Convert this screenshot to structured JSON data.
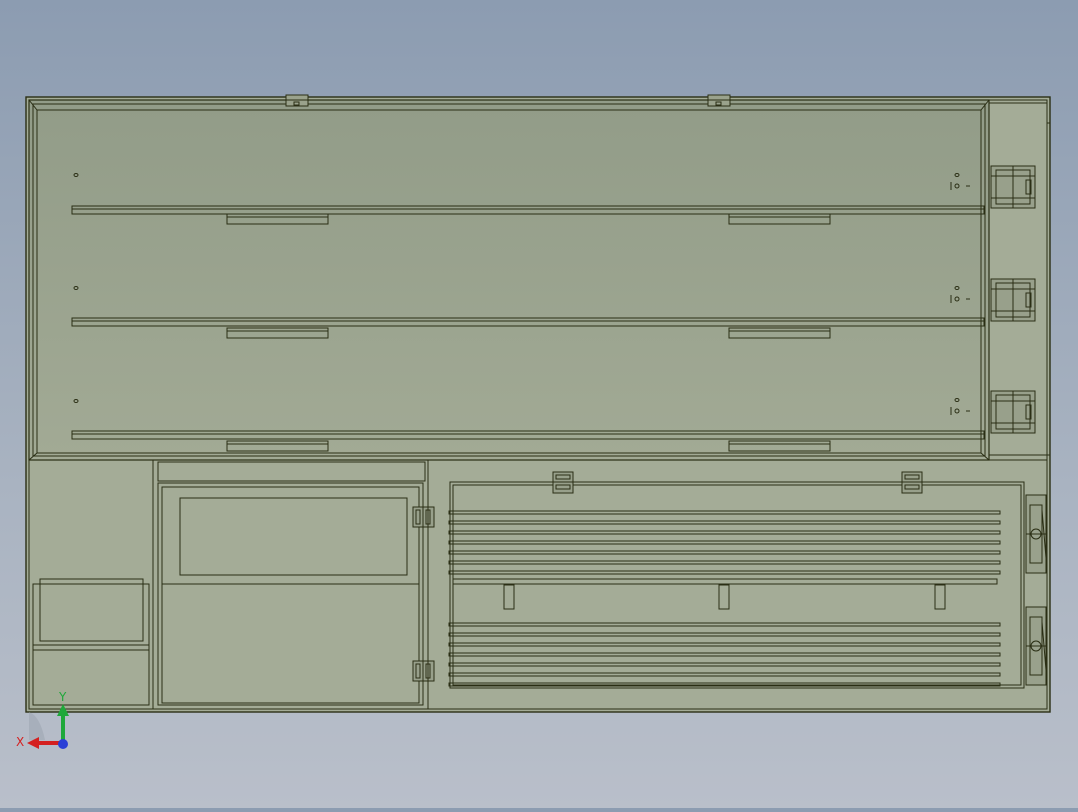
{
  "viewport": {
    "background_top": "#8c9cb1",
    "background_bottom": "#b9bfca"
  },
  "model": {
    "fill": "#9ea792",
    "fill_light": "#a5ad99",
    "edge": "#2a2e14"
  },
  "triad": {
    "x_label": "X",
    "y_label": "Y",
    "x_color": "#d42020",
    "y_color": "#1fa83a",
    "z_color": "#2a3fd6"
  }
}
